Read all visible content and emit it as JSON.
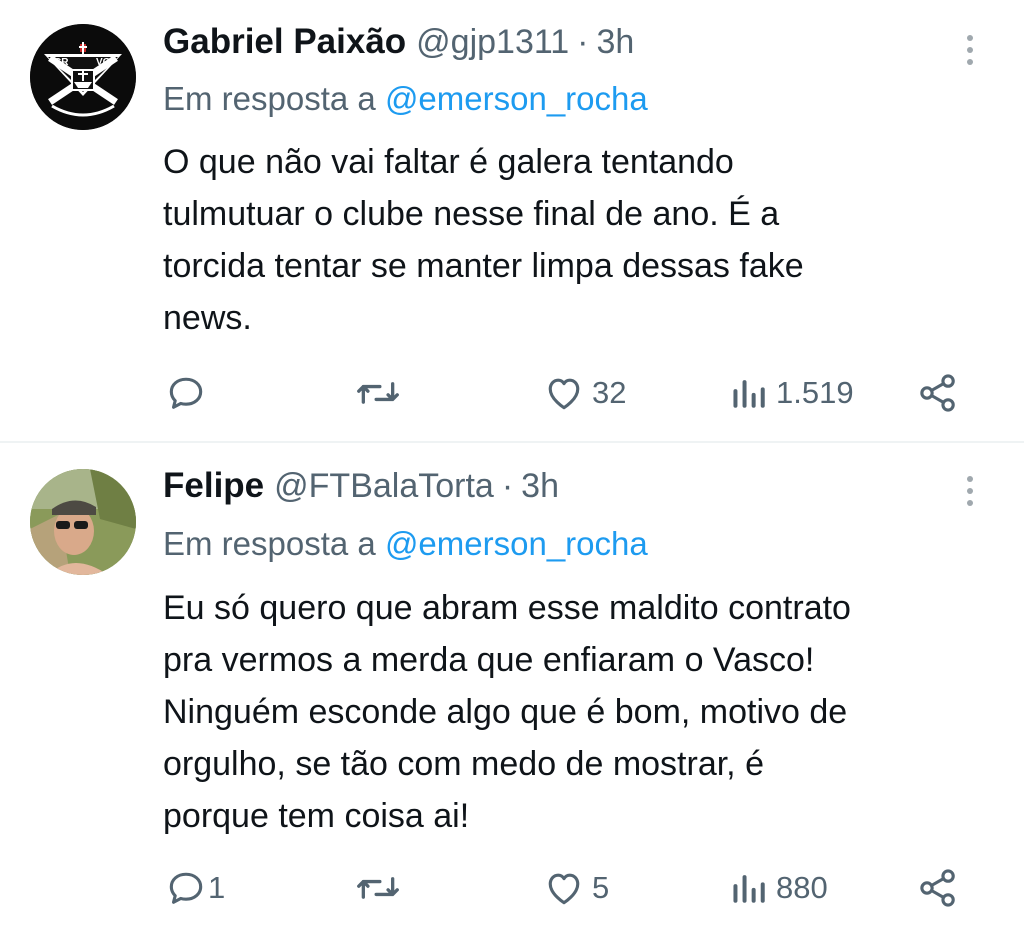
{
  "tweets": [
    {
      "name": "Gabriel Paixão",
      "handle": "@gjp1311",
      "separator": "·",
      "time": "3h",
      "reply_prefix": "Em resposta a",
      "reply_to": "@emerson_rocha",
      "avatar_text_left": "CR",
      "avatar_text_right": "VG",
      "body_lines": [
        "O que não vai faltar é galera tentando",
        "tulmutuar o clube nesse final de ano. É a",
        "torcida tentar se manter limpa dessas fake",
        "news."
      ],
      "replies": "",
      "likes": "32",
      "views": "1.519"
    },
    {
      "name": "Felipe",
      "handle": "@FTBalaTorta",
      "separator": "·",
      "time": "3h",
      "reply_prefix": "Em resposta a",
      "reply_to": "@emerson_rocha",
      "body_lines": [
        "Eu só quero que abram esse maldito contrato",
        "pra vermos a merda que enfiaram o Vasco!",
        "Ninguém esconde algo que é bom, motivo de",
        "orgulho, se tão com medo de mostrar, é",
        "porque tem coisa ai!"
      ],
      "replies": "1",
      "likes": "5",
      "views": "880"
    }
  ],
  "icons": {
    "reply": "reply-icon",
    "retweet": "retweet-icon",
    "like": "heart-icon",
    "views": "views-icon",
    "share": "share-icon",
    "more": "more-icon"
  },
  "colors": {
    "text": "#0f1419",
    "secondary": "#536471",
    "link": "#1d9bf0",
    "divider": "#eff3f4"
  }
}
